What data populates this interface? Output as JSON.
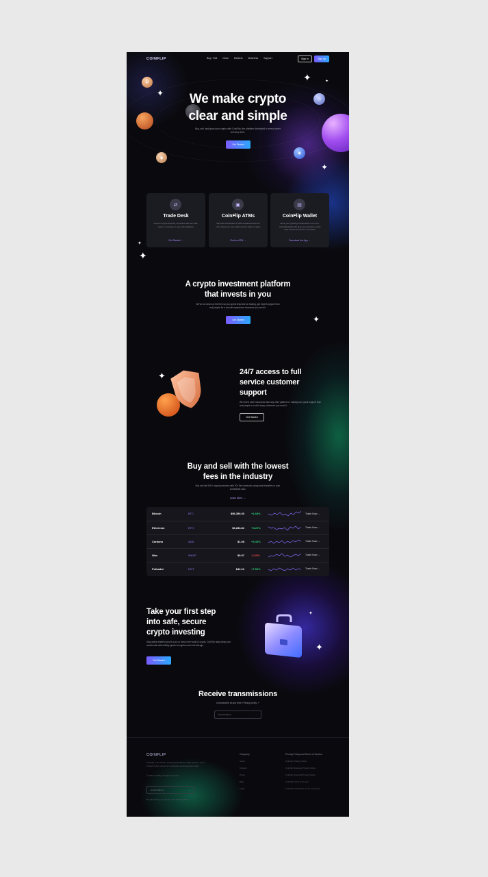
{
  "nav": {
    "logo": "COINFLIP",
    "links": [
      "Buy / Sell",
      "Grow",
      "Markets",
      "Business",
      "Support"
    ],
    "signin": "Sign in",
    "signup": "Sign up"
  },
  "hero": {
    "title_line1": "We make crypto",
    "title_line2": "clear and simple",
    "subtitle": "Buy, sell, and grow your crypto with CoinFlip, the platform dedicated to every trader at every level.",
    "cta": "Get Started"
  },
  "cards": [
    {
      "title": "Trade Desk",
      "desc": "Invest in crypto anytime, anywhere with our safe, secure, and easy to use online platform",
      "link": "Get Started →",
      "icon": "exchange-icon"
    },
    {
      "title": "CoinFlip ATMs",
      "desc": "We have thousands of ATMs located across the U.S. where you can easily convert cash to crypto",
      "link": "Find an ATM →",
      "icon": "atm-icon"
    },
    {
      "title": "CoinFlip Wallet",
      "desc": "Store your growing investments in our non-custodial wallet that gives you access to a full suite of DeFi services in one place",
      "link": "Download the App →",
      "icon": "wallet-icon"
    }
  ],
  "platform": {
    "title_line1": "A crypto investment platform",
    "title_line2": "that invests in you",
    "subtitle": "We've cut down on the fees so you spend less time on trading, get expert support from real people for a smooth experience whenever you need it.",
    "cta": "Get Started"
  },
  "support": {
    "title_line1": "24/7 access to full",
    "title_line2": "service customer",
    "title_line3": "support",
    "subtitle": "We invest more resources than any other platform in making sure great support from real people is a click away, whenever you need it.",
    "cta": "Get Started"
  },
  "fees": {
    "title_line1": "Buy and sell with the lowest",
    "title_line2": "fees in the industry",
    "subtitle": "Buy and sell 150+ cryptocurrencies with 20+ fiat currencies using bank transfers or your credit/debit card.",
    "link": "Learn More →"
  },
  "table": {
    "trade_label": "Trade Now →",
    "rows": [
      {
        "name": "Bitcoin",
        "symbol": "BTC",
        "price": "$56,350.30",
        "change": "+1.68%",
        "up": true
      },
      {
        "name": "Ethereum",
        "symbol": "ETH",
        "price": "$3,284.81",
        "change": "+4.26%",
        "up": true
      },
      {
        "name": "Cardano",
        "symbol": "ADA",
        "price": "$1.08",
        "change": "+3.43%",
        "up": true
      },
      {
        "name": "Wax",
        "symbol": "WAXP",
        "price": "$0.97",
        "change": "-2.63%",
        "up": false
      },
      {
        "name": "Polkadot",
        "symbol": "DOT",
        "price": "$42.22",
        "change": "+7.56%",
        "up": true
      }
    ]
  },
  "step": {
    "title_line1": "Take your first step",
    "title_line2": "into safe, secure",
    "title_line3": "crypto investing",
    "subtitle": "Stay active whether you're a pro or new to the world of crypto, CoinFlip helps keep your assets safe with military-grade encryption and cold storage.",
    "cta": "Get Started"
  },
  "newsletter": {
    "title": "Receive transmissions",
    "subtitle": "Unsubscribe at any time. Privacy policy ↗",
    "placeholder": "Email Address"
  },
  "footer": {
    "logo": "COINFLIP",
    "about": "CoinFlip is the world's leading global Bitcoin ATM network, and a trusted crypto partner for individuals and businesses alike.",
    "copyright": "© 2021 CoinFlip. All rights reserved.",
    "email_placeholder": "Email Address",
    "note": "By subscribing you agree to our Privacy Policy",
    "col1_head": "Company",
    "col1": [
      "About",
      "Careers",
      "Press",
      "Blog",
      "Legal"
    ],
    "col2_head": "Privacy Policy and Terms of Service",
    "col2": [
      "CoinFlip Privacy Notice",
      "CoinFlip Business Privacy Notice",
      "CoinFlip Financial Privacy Notice",
      "CoinFlip Terms of Service",
      "CoinFlip Trade Desk Terms of Service"
    ]
  },
  "colors": {
    "accent_start": "#7a5cff",
    "accent_end": "#2ba8ff",
    "positive": "#2fd17a",
    "negative": "#ff4d4d"
  }
}
